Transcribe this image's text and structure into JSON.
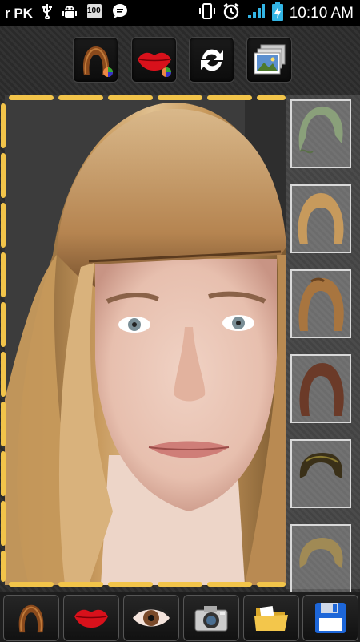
{
  "status_bar": {
    "carrier": "r PK",
    "battery_level": "100",
    "time": "10:10 AM"
  },
  "top_toolbar": {
    "buttons": [
      "hair-color",
      "lips-color",
      "flip",
      "gallery"
    ]
  },
  "hair_styles": {
    "items": [
      "hair-style-1",
      "hair-style-2",
      "hair-style-3",
      "hair-style-4",
      "hair-style-5",
      "hair-style-6"
    ],
    "colors": [
      "#8aa07a",
      "#c79a5c",
      "#a8753f",
      "#6b3a28",
      "#3a3018",
      "#a08a55"
    ]
  },
  "bottom_toolbar": {
    "buttons": [
      "hair",
      "lips",
      "eyes",
      "camera",
      "open-folder",
      "save"
    ]
  },
  "colors": {
    "frame_gold": "#f2c44a",
    "status_icon_blue": "#33b5e5"
  }
}
